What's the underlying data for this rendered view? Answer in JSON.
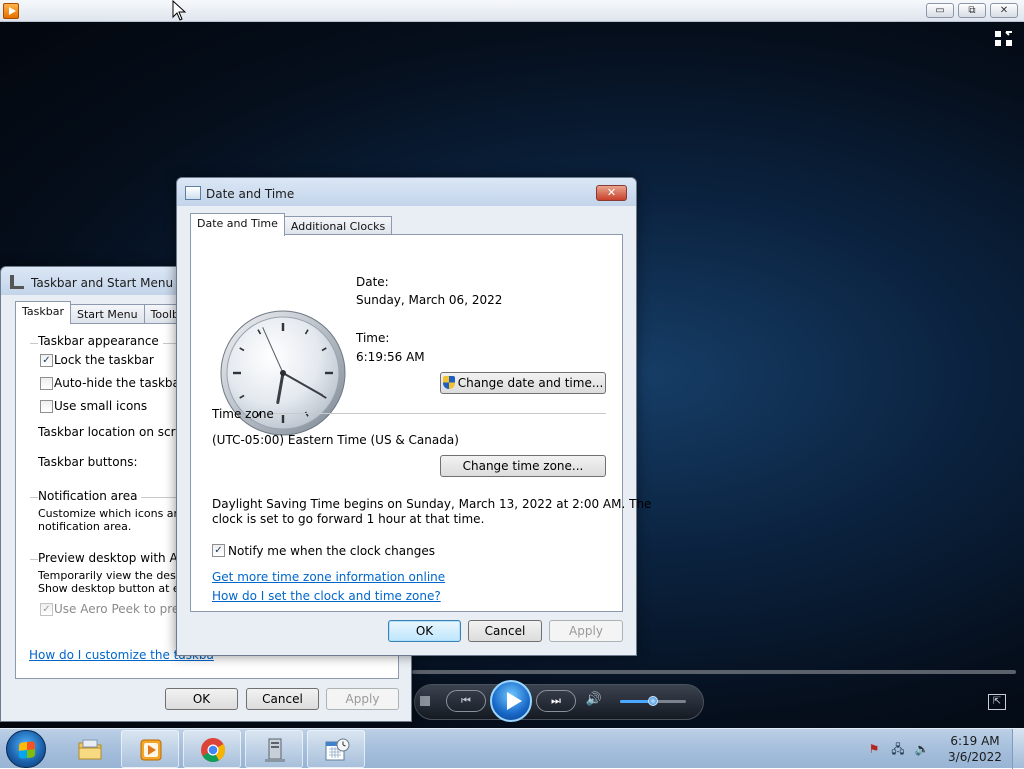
{
  "media_player": {
    "caption_min": "▭",
    "caption_max": "⧉",
    "caption_close": "✕",
    "prev_label": "⏮",
    "next_label": "⏭",
    "volume_level": 0.5,
    "accent_color": "#1868c8"
  },
  "taskbar_props": {
    "title": "Taskbar and Start Menu Pro",
    "tabs": [
      "Taskbar",
      "Start Menu",
      "Toolbars"
    ],
    "appearance_title": "Taskbar appearance",
    "lock_label": "Lock the taskbar",
    "lock_checked": "✓",
    "autohide_label": "Auto-hide the taskbar",
    "small_icons_label": "Use small icons",
    "location_label": "Taskbar location on screen:",
    "buttons_label": "Taskbar buttons:",
    "notification_title": "Notification area",
    "notification_text1": "Customize which icons and n",
    "notification_text2": "notification area.",
    "peek_title": "Preview desktop with Aero P",
    "peek_text1": "Temporarily view the desktop",
    "peek_text2": "Show desktop button at end",
    "peek_label": "Use Aero Peek to preview",
    "peek_checked": "✓",
    "help_link": "How do I customize the taskba",
    "ok": "OK",
    "cancel": "Cancel",
    "apply": "Apply"
  },
  "date_time": {
    "title": "Date and Time",
    "close": "✕",
    "tabs": [
      "Date and Time",
      "Additional Clocks"
    ],
    "date_label": "Date:",
    "date_value": "Sunday, March 06, 2022",
    "time_label": "Time:",
    "time_value": "6:19:56 AM",
    "change_datetime": "Change date and time...",
    "timezone_title": "Time zone",
    "timezone_value": "(UTC-05:00) Eastern Time (US & Canada)",
    "change_timezone": "Change time zone...",
    "dst_line1": "Daylight Saving Time begins on Sunday, March 13, 2022 at 2:00 AM. The",
    "dst_line2": "clock is set to go forward 1 hour at that time.",
    "notify_label": "Notify me when the clock changes",
    "notify_checked": "✓",
    "link_more_info": "Get more time zone information online",
    "link_how_set": "How do I set the clock and time zone?",
    "ok": "OK",
    "cancel": "Cancel",
    "apply": "Apply",
    "clock_hours": 6,
    "clock_minutes": 19,
    "clock_seconds": 56
  },
  "taskbar": {
    "clock_time": "6:19 AM",
    "clock_date": "3/6/2022"
  }
}
